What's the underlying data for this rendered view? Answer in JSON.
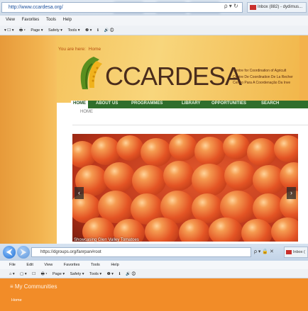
{
  "back_window": {
    "address": "http://www.ccardesa.org/",
    "address_icons": "ρ ▾ ↻",
    "mail_tab": "Inbox (882) - dydimus...",
    "menu": [
      "View",
      "Favorites",
      "Tools",
      "Help"
    ],
    "commands": [
      "▾ ☐ ▾",
      "🖶 ▾",
      "Page ▾",
      "Safety ▾",
      "Tools ▾",
      "❷ ▾",
      "ℹ",
      "🔊 🛈"
    ],
    "you_are_here": "You are here:",
    "breadcrumb_home": "Home",
    "logo_text": "CCARDESA",
    "tagline": [
      "Centre for Coordination of Agricult",
      "Centre De Coordination De La Recher",
      "Centro Para A Coordenação Da Inve"
    ],
    "nav": [
      "HOME",
      "ABOUT US",
      "PROGRAMMES",
      "LIBRARY",
      "OPPORTUNITIES",
      "SEARCH"
    ],
    "page_crumb": "HOME",
    "slide_caption": "Showcasing Glen Valley Tomatoes",
    "colors": {
      "nav_green": "#2f6e2c",
      "banner_orange": "#f2b34f"
    }
  },
  "front_window": {
    "address": "https://dgroups.org/fanrpan#root",
    "address_icons": "ρ ▾ 🔒 ✕",
    "mail_tab": "Inbox (",
    "menu": [
      "File",
      "Edit",
      "View",
      "Favorites",
      "Tools",
      "Help"
    ],
    "commands": [
      "⌂ ▾",
      "▢ ▾",
      "☐",
      "🖶 ▾",
      "Page ▾",
      "Safety ▾",
      "Tools ▾",
      "❷ ▾",
      "ℹ",
      "🔊 🛈"
    ],
    "header_title": "≡  My Communities",
    "home_link": "Home",
    "colors": {
      "header_orange": "#f28c28"
    }
  }
}
